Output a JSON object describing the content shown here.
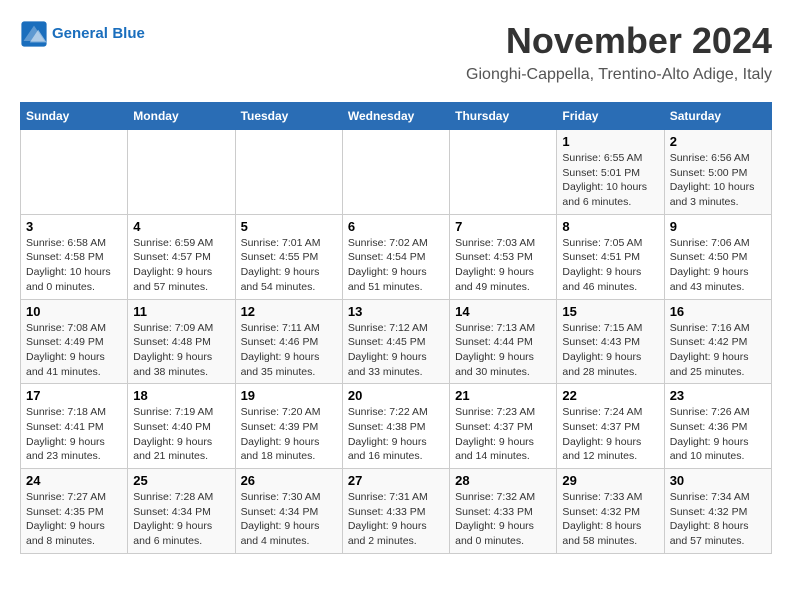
{
  "header": {
    "logo_line1": "General",
    "logo_line2": "Blue",
    "month_title": "November 2024",
    "location": "Gionghi-Cappella, Trentino-Alto Adige, Italy"
  },
  "days_of_week": [
    "Sunday",
    "Monday",
    "Tuesday",
    "Wednesday",
    "Thursday",
    "Friday",
    "Saturday"
  ],
  "weeks": [
    [
      {
        "day": "",
        "info": ""
      },
      {
        "day": "",
        "info": ""
      },
      {
        "day": "",
        "info": ""
      },
      {
        "day": "",
        "info": ""
      },
      {
        "day": "",
        "info": ""
      },
      {
        "day": "1",
        "info": "Sunrise: 6:55 AM\nSunset: 5:01 PM\nDaylight: 10 hours and 6 minutes."
      },
      {
        "day": "2",
        "info": "Sunrise: 6:56 AM\nSunset: 5:00 PM\nDaylight: 10 hours and 3 minutes."
      }
    ],
    [
      {
        "day": "3",
        "info": "Sunrise: 6:58 AM\nSunset: 4:58 PM\nDaylight: 10 hours and 0 minutes."
      },
      {
        "day": "4",
        "info": "Sunrise: 6:59 AM\nSunset: 4:57 PM\nDaylight: 9 hours and 57 minutes."
      },
      {
        "day": "5",
        "info": "Sunrise: 7:01 AM\nSunset: 4:55 PM\nDaylight: 9 hours and 54 minutes."
      },
      {
        "day": "6",
        "info": "Sunrise: 7:02 AM\nSunset: 4:54 PM\nDaylight: 9 hours and 51 minutes."
      },
      {
        "day": "7",
        "info": "Sunrise: 7:03 AM\nSunset: 4:53 PM\nDaylight: 9 hours and 49 minutes."
      },
      {
        "day": "8",
        "info": "Sunrise: 7:05 AM\nSunset: 4:51 PM\nDaylight: 9 hours and 46 minutes."
      },
      {
        "day": "9",
        "info": "Sunrise: 7:06 AM\nSunset: 4:50 PM\nDaylight: 9 hours and 43 minutes."
      }
    ],
    [
      {
        "day": "10",
        "info": "Sunrise: 7:08 AM\nSunset: 4:49 PM\nDaylight: 9 hours and 41 minutes."
      },
      {
        "day": "11",
        "info": "Sunrise: 7:09 AM\nSunset: 4:48 PM\nDaylight: 9 hours and 38 minutes."
      },
      {
        "day": "12",
        "info": "Sunrise: 7:11 AM\nSunset: 4:46 PM\nDaylight: 9 hours and 35 minutes."
      },
      {
        "day": "13",
        "info": "Sunrise: 7:12 AM\nSunset: 4:45 PM\nDaylight: 9 hours and 33 minutes."
      },
      {
        "day": "14",
        "info": "Sunrise: 7:13 AM\nSunset: 4:44 PM\nDaylight: 9 hours and 30 minutes."
      },
      {
        "day": "15",
        "info": "Sunrise: 7:15 AM\nSunset: 4:43 PM\nDaylight: 9 hours and 28 minutes."
      },
      {
        "day": "16",
        "info": "Sunrise: 7:16 AM\nSunset: 4:42 PM\nDaylight: 9 hours and 25 minutes."
      }
    ],
    [
      {
        "day": "17",
        "info": "Sunrise: 7:18 AM\nSunset: 4:41 PM\nDaylight: 9 hours and 23 minutes."
      },
      {
        "day": "18",
        "info": "Sunrise: 7:19 AM\nSunset: 4:40 PM\nDaylight: 9 hours and 21 minutes."
      },
      {
        "day": "19",
        "info": "Sunrise: 7:20 AM\nSunset: 4:39 PM\nDaylight: 9 hours and 18 minutes."
      },
      {
        "day": "20",
        "info": "Sunrise: 7:22 AM\nSunset: 4:38 PM\nDaylight: 9 hours and 16 minutes."
      },
      {
        "day": "21",
        "info": "Sunrise: 7:23 AM\nSunset: 4:37 PM\nDaylight: 9 hours and 14 minutes."
      },
      {
        "day": "22",
        "info": "Sunrise: 7:24 AM\nSunset: 4:37 PM\nDaylight: 9 hours and 12 minutes."
      },
      {
        "day": "23",
        "info": "Sunrise: 7:26 AM\nSunset: 4:36 PM\nDaylight: 9 hours and 10 minutes."
      }
    ],
    [
      {
        "day": "24",
        "info": "Sunrise: 7:27 AM\nSunset: 4:35 PM\nDaylight: 9 hours and 8 minutes."
      },
      {
        "day": "25",
        "info": "Sunrise: 7:28 AM\nSunset: 4:34 PM\nDaylight: 9 hours and 6 minutes."
      },
      {
        "day": "26",
        "info": "Sunrise: 7:30 AM\nSunset: 4:34 PM\nDaylight: 9 hours and 4 minutes."
      },
      {
        "day": "27",
        "info": "Sunrise: 7:31 AM\nSunset: 4:33 PM\nDaylight: 9 hours and 2 minutes."
      },
      {
        "day": "28",
        "info": "Sunrise: 7:32 AM\nSunset: 4:33 PM\nDaylight: 9 hours and 0 minutes."
      },
      {
        "day": "29",
        "info": "Sunrise: 7:33 AM\nSunset: 4:32 PM\nDaylight: 8 hours and 58 minutes."
      },
      {
        "day": "30",
        "info": "Sunrise: 7:34 AM\nSunset: 4:32 PM\nDaylight: 8 hours and 57 minutes."
      }
    ]
  ]
}
